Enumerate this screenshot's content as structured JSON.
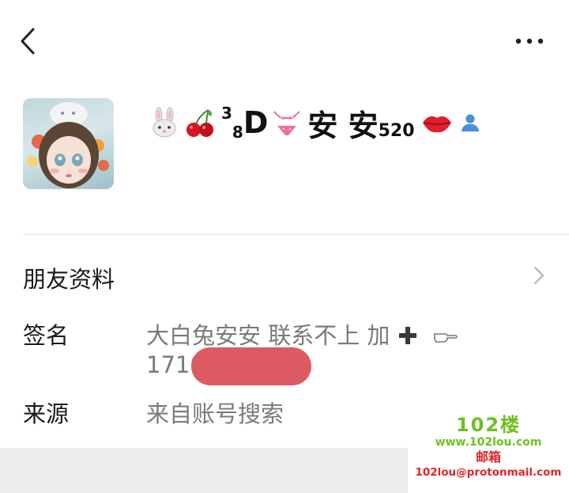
{
  "header": {
    "back_icon": "chevron-left-icon",
    "more_icon": "more-dots-icon"
  },
  "profile": {
    "avatar_alt": "",
    "nickname_parts": {
      "sup": "3",
      "sub": "8",
      "d": "D",
      "name": "安 安",
      "num": "520"
    },
    "icons": [
      "rabbit-emoji-icon",
      "cherry-emoji-icon",
      "bikini-emoji-icon",
      "kiss-lips-emoji-icon",
      "contact-person-icon"
    ]
  },
  "sections": {
    "friend_info": "朋友资料",
    "signature_label": "签名",
    "signature_value_line1": "大白兔安安      联系不上 加",
    "signature_value_line2": "1710",
    "source_label": "来源",
    "source_value": "来自账号搜索"
  },
  "watermark": {
    "big": "102楼",
    "site": "www.102lou.com",
    "mail_label": "邮箱",
    "mail": "102lou@protonmail.com"
  },
  "colors": {
    "redaction": "#dc5b62",
    "watermark_green": "#6ec01e",
    "watermark_red": "#e0242b"
  }
}
